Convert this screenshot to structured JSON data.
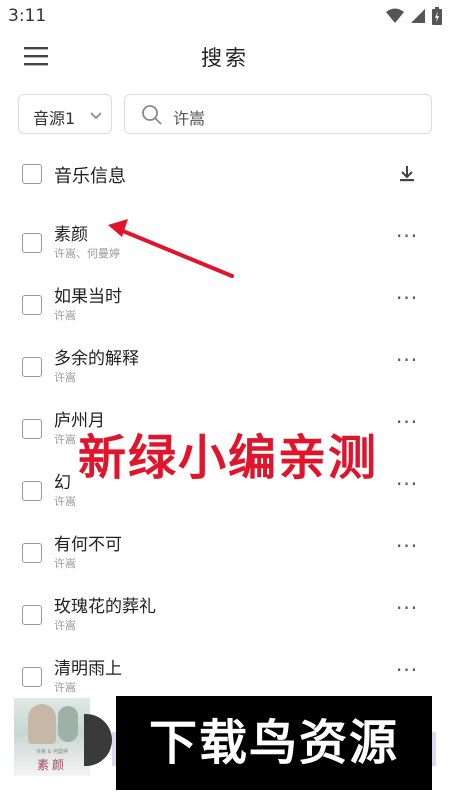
{
  "status": {
    "time": "3:11"
  },
  "header": {
    "title": "搜索"
  },
  "search": {
    "source": "音源1",
    "query": "许嵩"
  },
  "list_header": {
    "label": "音乐信息"
  },
  "songs": [
    {
      "title": "素颜",
      "artist": "许嵩、何曼婷"
    },
    {
      "title": "如果当时",
      "artist": "许嵩"
    },
    {
      "title": "多余的解释",
      "artist": "许嵩"
    },
    {
      "title": "庐州月",
      "artist": "许嵩"
    },
    {
      "title": "幻",
      "artist": "许嵩"
    },
    {
      "title": "有何不可",
      "artist": "许嵩"
    },
    {
      "title": "玫瑰花的葬礼",
      "artist": "许嵩"
    },
    {
      "title": "清明雨上",
      "artist": "许嵩"
    }
  ],
  "more_label": "···",
  "overlay": {
    "watermark": "新绿小编亲测",
    "banner": "下载鸟资源"
  },
  "player": {
    "cover_title": "素颜",
    "cover_small": "许嵩 & 何曼婷"
  },
  "colors": {
    "annotation_arrow": "#e0142b",
    "banner_bg": "#000000",
    "player_accent": "#e3d6f0"
  }
}
